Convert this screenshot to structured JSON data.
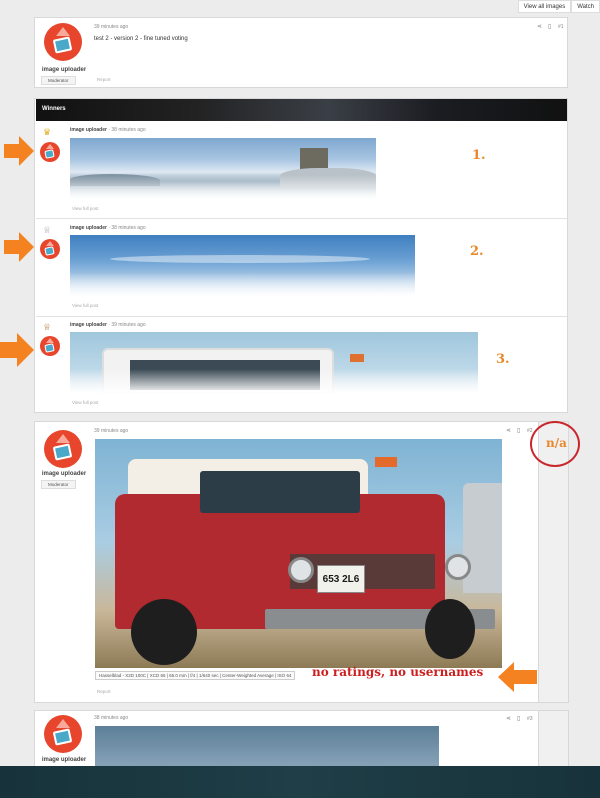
{
  "topbar": {
    "view_all": "View all images",
    "watch": "Watch"
  },
  "post1": {
    "time": "39 minutes ago",
    "num": "#1",
    "text": "test 2 - version 2 - fine tuned voting",
    "author": "image uploader",
    "role": "Moderator",
    "report": "Report"
  },
  "winners": {
    "title": "Winners",
    "items": [
      {
        "author": "image uploader",
        "time": "38 minutes ago",
        "view": "View full post",
        "rank": "1.",
        "crown": "gold"
      },
      {
        "author": "image uploader",
        "time": "38 minutes ago",
        "view": "View full post",
        "rank": "2.",
        "crown": "silver"
      },
      {
        "author": "image uploader",
        "time": "39 minutes ago",
        "view": "View full post",
        "rank": "3.",
        "crown": "bronze"
      }
    ]
  },
  "post2": {
    "time": "39 minutes ago",
    "num": "#2",
    "author": "image uploader",
    "role": "Moderator",
    "exif": "Hasselblad - X2D 100C | XCD 65 | 65.0 mm | f/4 | 1/640 sec | Center-Weighted Average | ISO 64",
    "report": "Report",
    "plate": "653 2L6",
    "na_note": "n/a",
    "annotation": "no ratings, no usernames"
  },
  "post3": {
    "time": "38 minutes ago",
    "num": "#3",
    "author": "image uploader"
  },
  "colors": {
    "accent": "#f58220",
    "annotation_red": "#cc1f1f",
    "rank_orange": "#e8882a"
  }
}
